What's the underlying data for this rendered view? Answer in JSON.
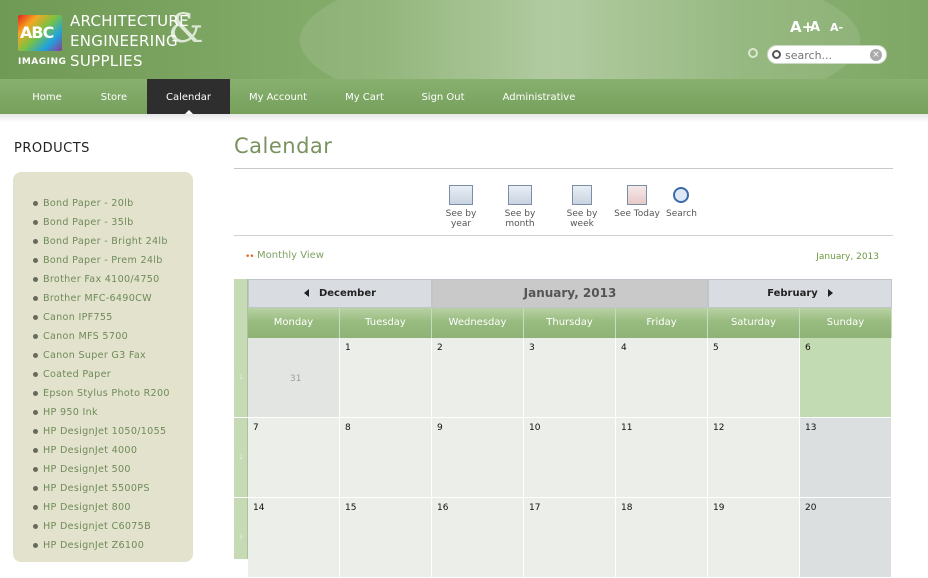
{
  "header": {
    "logo_abc": "ABC",
    "logo_imaging": "IMAGING",
    "brand_lines": [
      "ARCHITECTURE",
      "ENGINEERING",
      "SUPPLIES"
    ],
    "brand_amp": "&",
    "font_sizes": [
      "A+",
      "A",
      "A-"
    ],
    "search_placeholder": "search..."
  },
  "nav": {
    "items": [
      "Home",
      "Store",
      "Calendar",
      "My Account",
      "My Cart",
      "Sign Out",
      "Administrative"
    ],
    "active": "Calendar"
  },
  "sidebar": {
    "title": "PRODUCTS",
    "items": [
      "Bond Paper - 20lb",
      "Bond Paper - 35lb",
      "Bond Paper - Bright 24lb",
      "Bond Paper - Prem 24lb",
      "Brother Fax 4100/4750",
      "Brother MFC-6490CW",
      "Canon IPF755",
      "Canon MFS 5700",
      "Canon Super G3 Fax",
      "Coated Paper",
      "Epson Stylus Photo R200",
      "HP 950 Ink",
      "HP DesignJet 1050/1055",
      "HP DesignJet 4000",
      "HP DesignJet 500",
      "HP DesignJet 5500PS",
      "HP DesignJet 800",
      "HP Designjet C6075B",
      "HP DesignJet Z6100"
    ]
  },
  "main": {
    "title": "Calendar",
    "view_buttons": [
      "See by year",
      "See by month",
      "See by week",
      "See Today",
      "Search"
    ],
    "monthly_view_dots": "••",
    "monthly_view_label": "Monthly View",
    "monthly_view_date": "January, 2013"
  },
  "calendar": {
    "prev_label": "December",
    "current_label": "January, 2013",
    "next_label": "February",
    "day_names": [
      "Monday",
      "Tuesday",
      "Wednesday",
      "Thursday",
      "Friday",
      "Saturday",
      "Sunday"
    ],
    "week_numbers": [
      "1",
      "2",
      "3"
    ],
    "weeks": [
      [
        "31",
        "1",
        "2",
        "3",
        "4",
        "5",
        "6"
      ],
      [
        "7",
        "8",
        "9",
        "10",
        "11",
        "12",
        "13"
      ],
      [
        "14",
        "15",
        "16",
        "17",
        "18",
        "19",
        "20"
      ]
    ]
  },
  "colors": {
    "header_green": "#7ea765",
    "nav_green": "#76a05c",
    "nav_active": "#2e2e2e",
    "today_cell": "#c3dbb2",
    "title_green": "#7a9260"
  }
}
